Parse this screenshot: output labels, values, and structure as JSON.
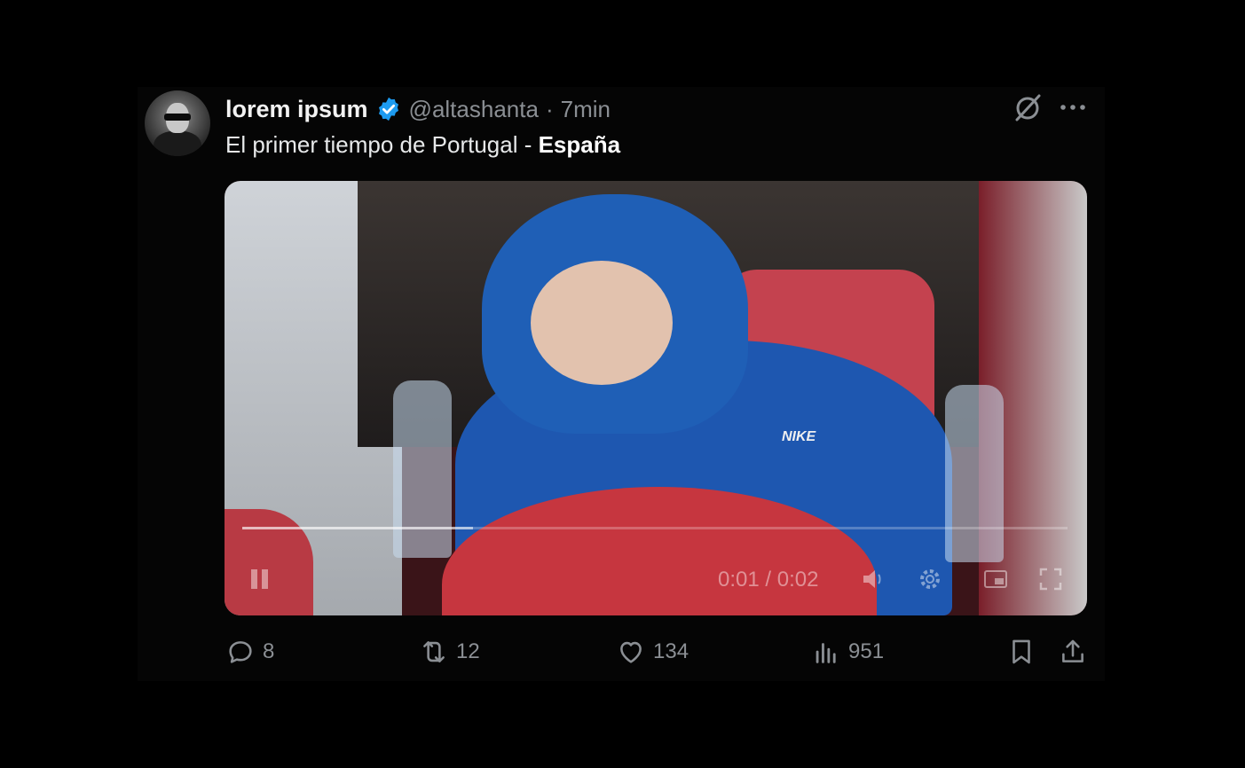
{
  "tweet": {
    "author_name": "lorem ipsum",
    "handle": "@altashanta",
    "separator": "·",
    "time": "7min",
    "text_plain": "El primer tiempo de Portugal - ",
    "text_bold": "España"
  },
  "media": {
    "type": "video",
    "jersey_text": "NIKE",
    "time_display": "0:01 / 0:02",
    "progress": 0.28
  },
  "actions": {
    "replies": "8",
    "reposts": "12",
    "likes": "134",
    "views": "951"
  },
  "icons": {
    "verified": "verified-badge-icon",
    "grok": "grok-icon",
    "more": "more-options-icon",
    "reply": "reply-icon",
    "repost": "repost-icon",
    "like": "like-icon",
    "views": "views-icon",
    "bookmark": "bookmark-icon",
    "share": "share-icon"
  },
  "colors": {
    "background": "#000000",
    "verified_blue": "#1d9bf0",
    "text": "#e7e9ea",
    "muted": "#8b8f94"
  }
}
